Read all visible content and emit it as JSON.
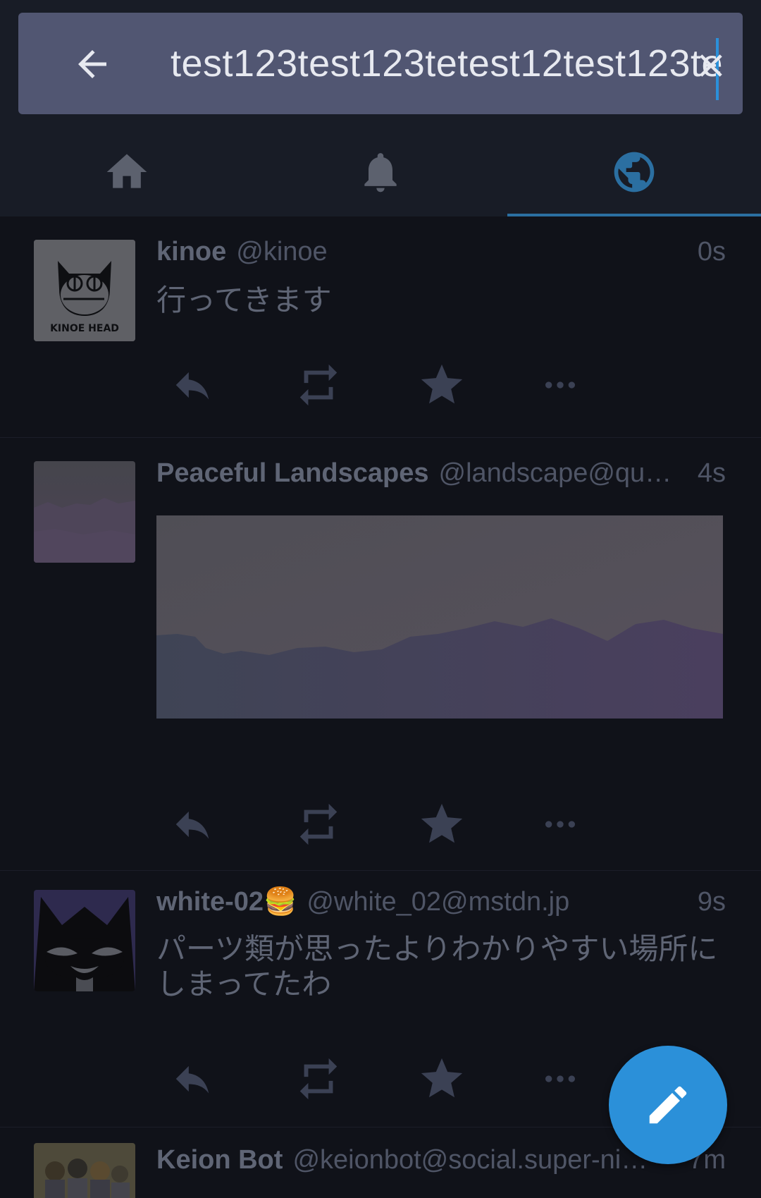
{
  "search": {
    "value": "test123test123tetest12test123te",
    "back_icon": "arrow-left-icon",
    "clear_icon": "close-icon"
  },
  "tabs": [
    {
      "name": "home",
      "icon": "home-icon",
      "active": false
    },
    {
      "name": "notifications",
      "icon": "bell-icon",
      "active": false
    },
    {
      "name": "federated",
      "icon": "globe-icon",
      "active": true
    }
  ],
  "statuses": [
    {
      "display_name": "kinoe",
      "acct": "@kinoe",
      "time": "0s",
      "content": "行ってきます",
      "avatar_text": "KINOE HEAD"
    },
    {
      "display_name": "Peaceful Landscapes",
      "acct": "@landscape@qu…",
      "time": "4s",
      "content": "",
      "has_media": true
    },
    {
      "display_name": "white-02🍔",
      "acct": "@white_02@mstdn.jp",
      "time": "9s",
      "content": "パーツ類が思ったよりわかりやすい場所にしまってたわ"
    },
    {
      "display_name": "Keion Bot",
      "acct": "@keionbot@social.super-ni…",
      "time": "7m",
      "content": ""
    }
  ],
  "colors": {
    "accent": "#2b90d9",
    "searchbar": "#515672",
    "background": "#101219"
  },
  "fab": {
    "icon": "pencil-icon"
  }
}
